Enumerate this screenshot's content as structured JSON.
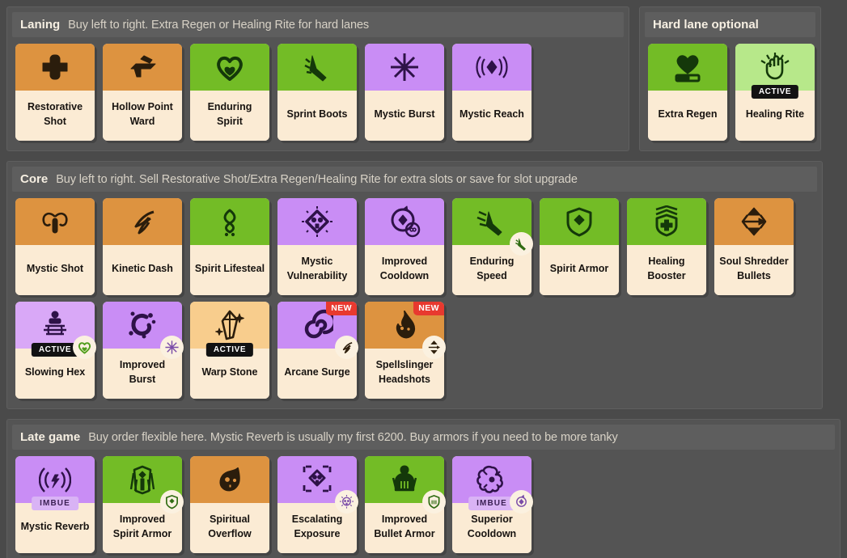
{
  "sections": [
    {
      "id": "laning",
      "title": "Laning",
      "subtitle": "Buy left to right. Extra Regen or Healing Rite for hard lanes",
      "rows": [
        [
          {
            "name": "Restorative Shot",
            "color": "orange",
            "icon": "bullet-cross-icon"
          },
          {
            "name": "Hollow Point Ward",
            "color": "orange",
            "icon": "pistol-icon"
          },
          {
            "name": "Enduring Spirit",
            "color": "green",
            "icon": "heart-icon"
          },
          {
            "name": "Sprint Boots",
            "color": "green",
            "icon": "boot-icon"
          },
          {
            "name": "Mystic Burst",
            "color": "purple",
            "icon": "starburst-icon"
          },
          {
            "name": "Mystic Reach",
            "color": "purple",
            "icon": "sound-waves-icon"
          }
        ]
      ]
    },
    {
      "id": "hard-lane",
      "title": "Hard lane optional",
      "subtitle": "",
      "rows": [
        [
          {
            "name": "Extra Regen",
            "color": "green",
            "icon": "heart-bar-icon"
          },
          {
            "name": "Healing Rite",
            "color": "lightgreen",
            "icon": "healing-hand-icon",
            "badge": "ACTIVE"
          }
        ]
      ]
    },
    {
      "id": "core",
      "title": "Core",
      "subtitle": "Buy left to right. Sell Restorative Shot/Extra Regen/Healing Rite for extra slots or save for slot upgrade",
      "rows": [
        [
          {
            "name": "Mystic Shot",
            "color": "orange",
            "icon": "mystic-shot-icon"
          },
          {
            "name": "Kinetic Dash",
            "color": "orange",
            "icon": "dash-icon"
          },
          {
            "name": "Spirit Lifesteal",
            "color": "green",
            "icon": "spirit-lifesteal-icon"
          },
          {
            "name": "Mystic Vulnerability",
            "color": "purple",
            "icon": "skull-diamond-icon"
          },
          {
            "name": "Improved Cooldown",
            "color": "purple",
            "icon": "cooldown-icon"
          },
          {
            "name": "Enduring Speed",
            "color": "green",
            "icon": "winged-boot-icon",
            "upgrade": "boot-upgrade-icon",
            "upgrade_color": "dgreen"
          },
          {
            "name": "Spirit Armor",
            "color": "green",
            "icon": "spirit-shield-icon"
          },
          {
            "name": "Healing Booster",
            "color": "green",
            "icon": "healing-shield-icon"
          },
          {
            "name": "Soul Shredder Bullets",
            "color": "orange",
            "icon": "shredder-icon"
          }
        ],
        [
          {
            "name": "Slowing Hex",
            "color": "lightpurple",
            "icon": "hex-icon",
            "badge": "ACTIVE",
            "upgrade": "heart-upgrade-icon",
            "upgrade_color": "green"
          },
          {
            "name": "Improved Burst",
            "color": "purple",
            "icon": "burst-icon",
            "upgrade": "starburst-upgrade-icon",
            "upgrade_color": "purple"
          },
          {
            "name": "Warp Stone",
            "color": "tan",
            "icon": "crystal-icon",
            "badge": "ACTIVE"
          },
          {
            "name": "Arcane Surge",
            "color": "purple",
            "icon": "spiral-icon",
            "new": "NEW",
            "upgrade": "dash-upgrade-icon",
            "upgrade_color": "orange"
          },
          {
            "name": "Spellslinger Headshots",
            "color": "orange",
            "icon": "flame-skull-icon",
            "new": "NEW",
            "upgrade": "shredder-upgrade-icon",
            "upgrade_color": "orange"
          }
        ]
      ]
    },
    {
      "id": "late-game",
      "title": "Late game",
      "subtitle": "Buy order flexible here. Mystic Reverb is usually my first 6200. Buy armors if you need to be more tanky",
      "rows": [
        [
          {
            "name": "Mystic Reverb",
            "color": "purple",
            "icon": "reverb-icon",
            "badge": "IMBUE"
          },
          {
            "name": "Improved Spirit Armor",
            "color": "green",
            "icon": "spirit-armor-body-icon",
            "upgrade": "spirit-shield-upgrade-icon",
            "upgrade_color": "dgreen"
          },
          {
            "name": "Spiritual Overflow",
            "color": "orange",
            "icon": "skull-flame-icon"
          },
          {
            "name": "Escalating Exposure",
            "color": "purple",
            "icon": "escalating-skull-icon",
            "upgrade": "skull-upgrade-icon",
            "upgrade_color": "purple"
          },
          {
            "name": "Improved Bullet Armor",
            "color": "green",
            "icon": "bullet-armor-icon",
            "upgrade": "armor-shield-upgrade-icon",
            "upgrade_color": "dgreen"
          },
          {
            "name": "Superior Cooldown",
            "color": "purple",
            "icon": "superior-cooldown-icon",
            "badge": "IMBUE",
            "upgrade": "cooldown-upgrade-icon",
            "upgrade_color": "purple"
          }
        ]
      ]
    }
  ],
  "colors": {
    "orange": "#dd9340",
    "green": "#73bc26",
    "purple": "#c98df5",
    "light_green": "#b7e88a",
    "light_purple": "#d9a8f7",
    "tan": "#f8cd8d",
    "label_cream": "#fbebd4",
    "panel": "#545454",
    "background": "#4a4a4a",
    "new_badge": "#e8392f"
  }
}
